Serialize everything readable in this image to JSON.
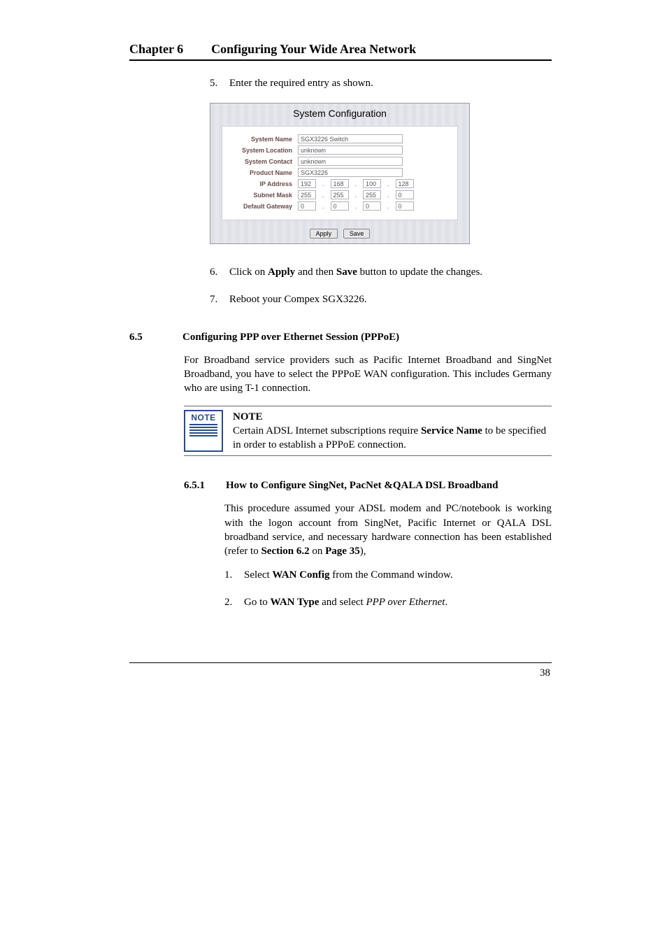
{
  "header": {
    "chapter": "Chapter 6",
    "title": "Configuring Your Wide Area Network"
  },
  "steps_top": {
    "s5_num": "5.",
    "s5_text": "Enter the required entry as shown.",
    "s6_num": "6.",
    "s6_pre": "Click on ",
    "s6_b1": "Apply",
    "s6_mid": " and then ",
    "s6_b2": "Save",
    "s6_post": " button to update the changes.",
    "s7_num": "7.",
    "s7_text": "Reboot your Compex SGX3226."
  },
  "figure": {
    "title": "System Configuration",
    "rows": {
      "system_name_label": "System Name",
      "system_name_value": "SGX3226 Switch",
      "system_location_label": "System Location",
      "system_location_value": "unknown",
      "system_contact_label": "System Contact",
      "system_contact_value": "unknown",
      "product_name_label": "Product Name",
      "product_name_value": "SGX3226",
      "ip_address_label": "IP Address",
      "ip": [
        "192",
        "168",
        "100",
        "128"
      ],
      "subnet_mask_label": "Subnet Mask",
      "mask": [
        "255",
        "255",
        "255",
        "0"
      ],
      "default_gateway_label": "Default Gateway",
      "gw": [
        "0",
        "0",
        "0",
        "0"
      ]
    },
    "btn_apply": "Apply",
    "btn_save": "Save"
  },
  "section": {
    "num": "6.5",
    "title": "Configuring PPP over Ethernet Session (PPPoE)",
    "para": "For Broadband service providers such as Pacific Internet Broadband and SingNet Broadband, you have to select the PPPoE WAN configuration. This includes Germany who are using T-1 connection."
  },
  "note": {
    "icon_label": "NOTE",
    "heading": "NOTE",
    "text_pre": "Certain ADSL Internet subscriptions require ",
    "text_bold": "Service Name",
    "text_post": " to be specified in order to establish a PPPoE connection."
  },
  "subsection": {
    "num": "6.5.1",
    "title": "How to Configure SingNet, PacNet &QALA DSL Broadband",
    "para_pre": "This procedure assumed your ADSL modem and PC/notebook is working with the logon account from SingNet, Pacific Internet or QALA DSL broadband service, and necessary hardware connection has been established (refer to ",
    "para_b1": "Section 6.2",
    "para_mid": " on ",
    "para_b2": "Page 35",
    "para_post": "),",
    "s1_num": "1.",
    "s1_pre": "Select ",
    "s1_b": "WAN Config",
    "s1_post": " from the Command window.",
    "s2_num": "2.",
    "s2_pre": "Go to ",
    "s2_b": "WAN Type",
    "s2_mid": " and select ",
    "s2_i": "PPP over Ethernet",
    "s2_post": "."
  },
  "page_number": "38"
}
